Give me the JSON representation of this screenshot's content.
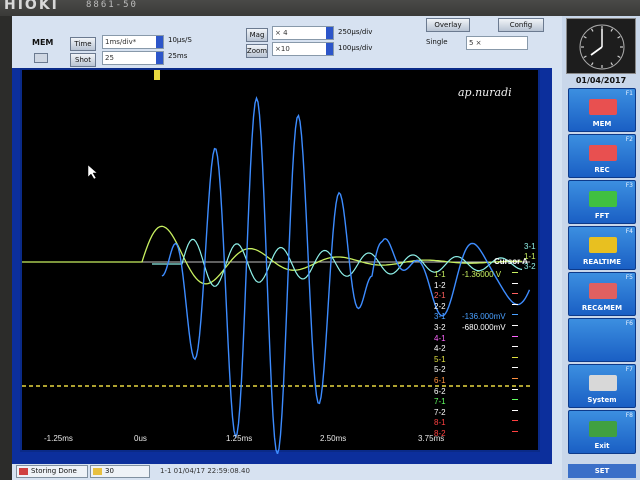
{
  "device": {
    "brand": "HIOKI",
    "model": "8861-50"
  },
  "toolbar": {
    "mode_label": "MEM",
    "time_button": "Time",
    "time_value": "1ms/div*",
    "sample_rate": "10μs/S",
    "shot_button": "Shot",
    "shot_value": "25",
    "shot_duration": "25ms",
    "mag_button": "Mag",
    "mag_value": "× 4",
    "mag_div": "250μs/div",
    "zoom_button": "Zoom",
    "zoom_value": "×10",
    "zoom_div": "100μs/div",
    "overlay_button": "Overlay",
    "config_button": "Config",
    "single_label": "Single",
    "single_value": "5 ×"
  },
  "watermark": "ap.nuradi",
  "waveform": {
    "cursor_label": "Cursor A",
    "channels": [
      {
        "name": "1-1",
        "value": "-1.36000 V",
        "color": "#c8f060"
      },
      {
        "name": "1-2",
        "value": "",
        "color": "#ffffff"
      },
      {
        "name": "2-1",
        "value": "",
        "color": "#ff6060"
      },
      {
        "name": "2-2",
        "value": "",
        "color": "#ffffff"
      },
      {
        "name": "3-1",
        "value": "-136.000mV",
        "color": "#4aa0ff"
      },
      {
        "name": "3-2",
        "value": "-680.000mV",
        "color": "#ffffff"
      },
      {
        "name": "4-1",
        "value": "",
        "color": "#ff66ff"
      },
      {
        "name": "4-2",
        "value": "",
        "color": "#ffffff"
      },
      {
        "name": "5-1",
        "value": "",
        "color": "#e0e040"
      },
      {
        "name": "5-2",
        "value": "",
        "color": "#ffffff"
      },
      {
        "name": "6-1",
        "value": "",
        "color": "#ff9040"
      },
      {
        "name": "6-2",
        "value": "",
        "color": "#ffffff"
      },
      {
        "name": "7-1",
        "value": "",
        "color": "#60ff60"
      },
      {
        "name": "7-2",
        "value": "",
        "color": "#ffffff"
      },
      {
        "name": "8-1",
        "value": "",
        "color": "#ff4040"
      },
      {
        "name": "8-2",
        "value": "",
        "color": "#ff4040"
      }
    ],
    "right_markers": [
      "3-1",
      "1-1",
      "3-2"
    ],
    "time_ticks": [
      "-1.25ms",
      "0us",
      "1.25ms",
      "2.50ms",
      "3.75ms"
    ],
    "colors": {
      "ch1": "#c8f060",
      "ch3": "#3d8cff",
      "ch3_2": "#8ef0e8",
      "trigger": "#e8d840"
    }
  },
  "right_panel": {
    "date": "01/04/2017",
    "buttons": [
      {
        "key": "F1",
        "label": "MEM"
      },
      {
        "key": "F2",
        "label": "REC"
      },
      {
        "key": "F3",
        "label": "FFT"
      },
      {
        "key": "F4",
        "label": "REALTIME"
      },
      {
        "key": "F5",
        "label": "REC&MEM"
      },
      {
        "key": "F6",
        "label": ""
      },
      {
        "key": "F7",
        "label": "System"
      },
      {
        "key": "F8",
        "label": "Exit"
      }
    ],
    "set_label": "SET"
  },
  "status_bar": {
    "storing": "Storing Done",
    "count": "30",
    "info": "1-1 01/04/17 22:59:08.40"
  }
}
